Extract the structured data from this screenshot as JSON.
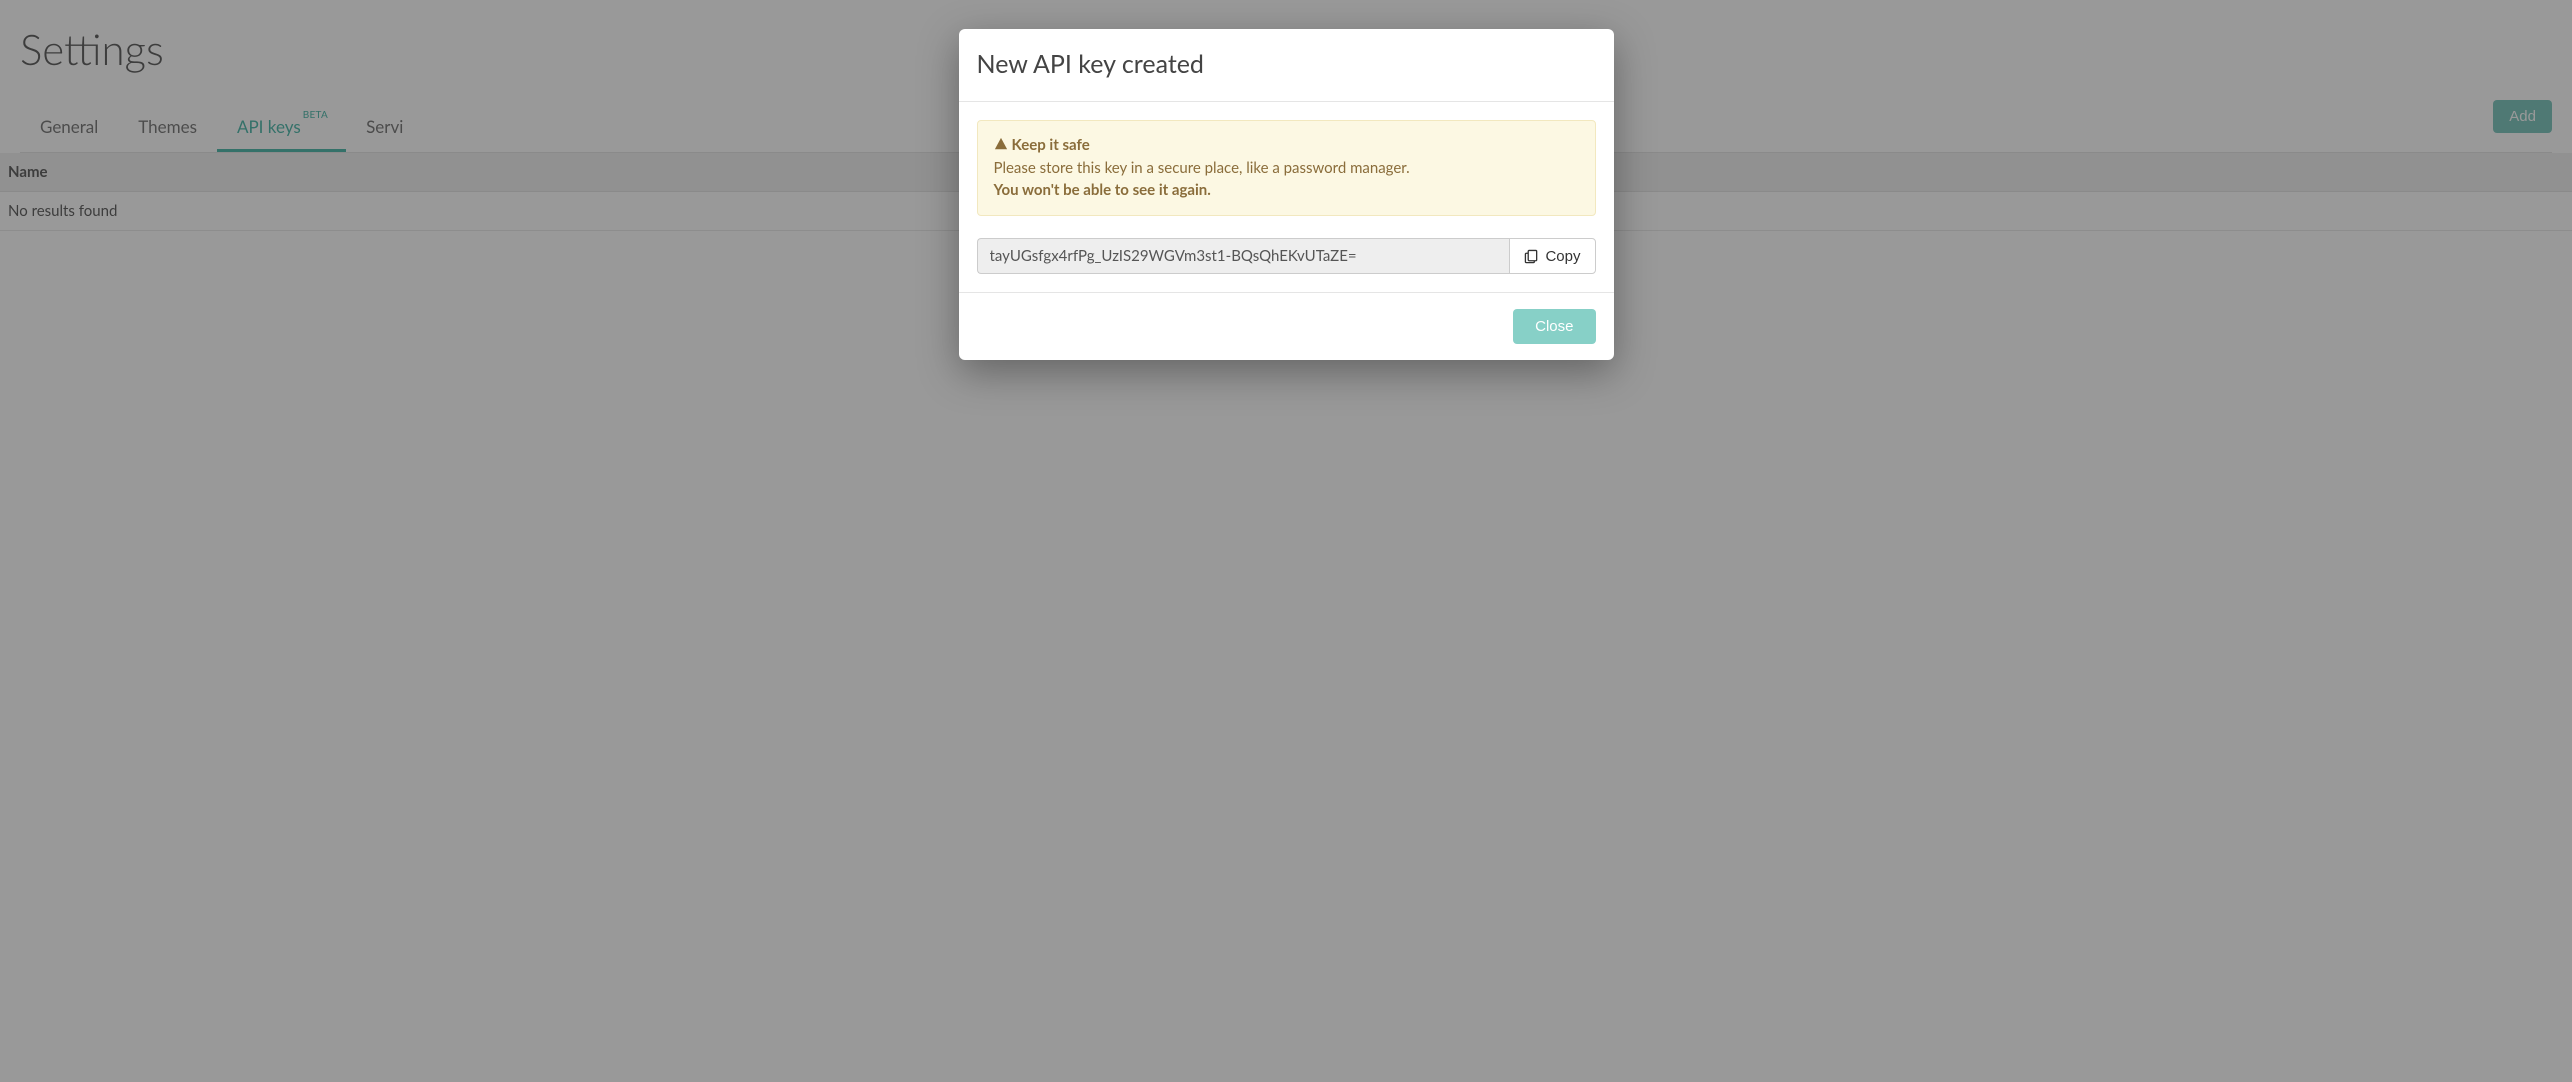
{
  "page": {
    "title": "Settings"
  },
  "tabs": {
    "general": "General",
    "themes": "Themes",
    "apikeys": "API keys",
    "apikeys_badge": "BETA",
    "services": "Servi"
  },
  "buttons": {
    "add": "Add"
  },
  "table": {
    "header_name": "Name",
    "empty": "No results found"
  },
  "modal": {
    "title": "New API key created",
    "alert_title": "Keep it safe",
    "alert_body": "Please store this key in a secure place, like a password manager.",
    "alert_strong": "You won't be able to see it again.",
    "key_value": "tayUGsfgx4rfPg_UzIS29WGVm3st1-BQsQhEKvUTaZE=",
    "copy_label": "Copy",
    "close_label": "Close"
  }
}
